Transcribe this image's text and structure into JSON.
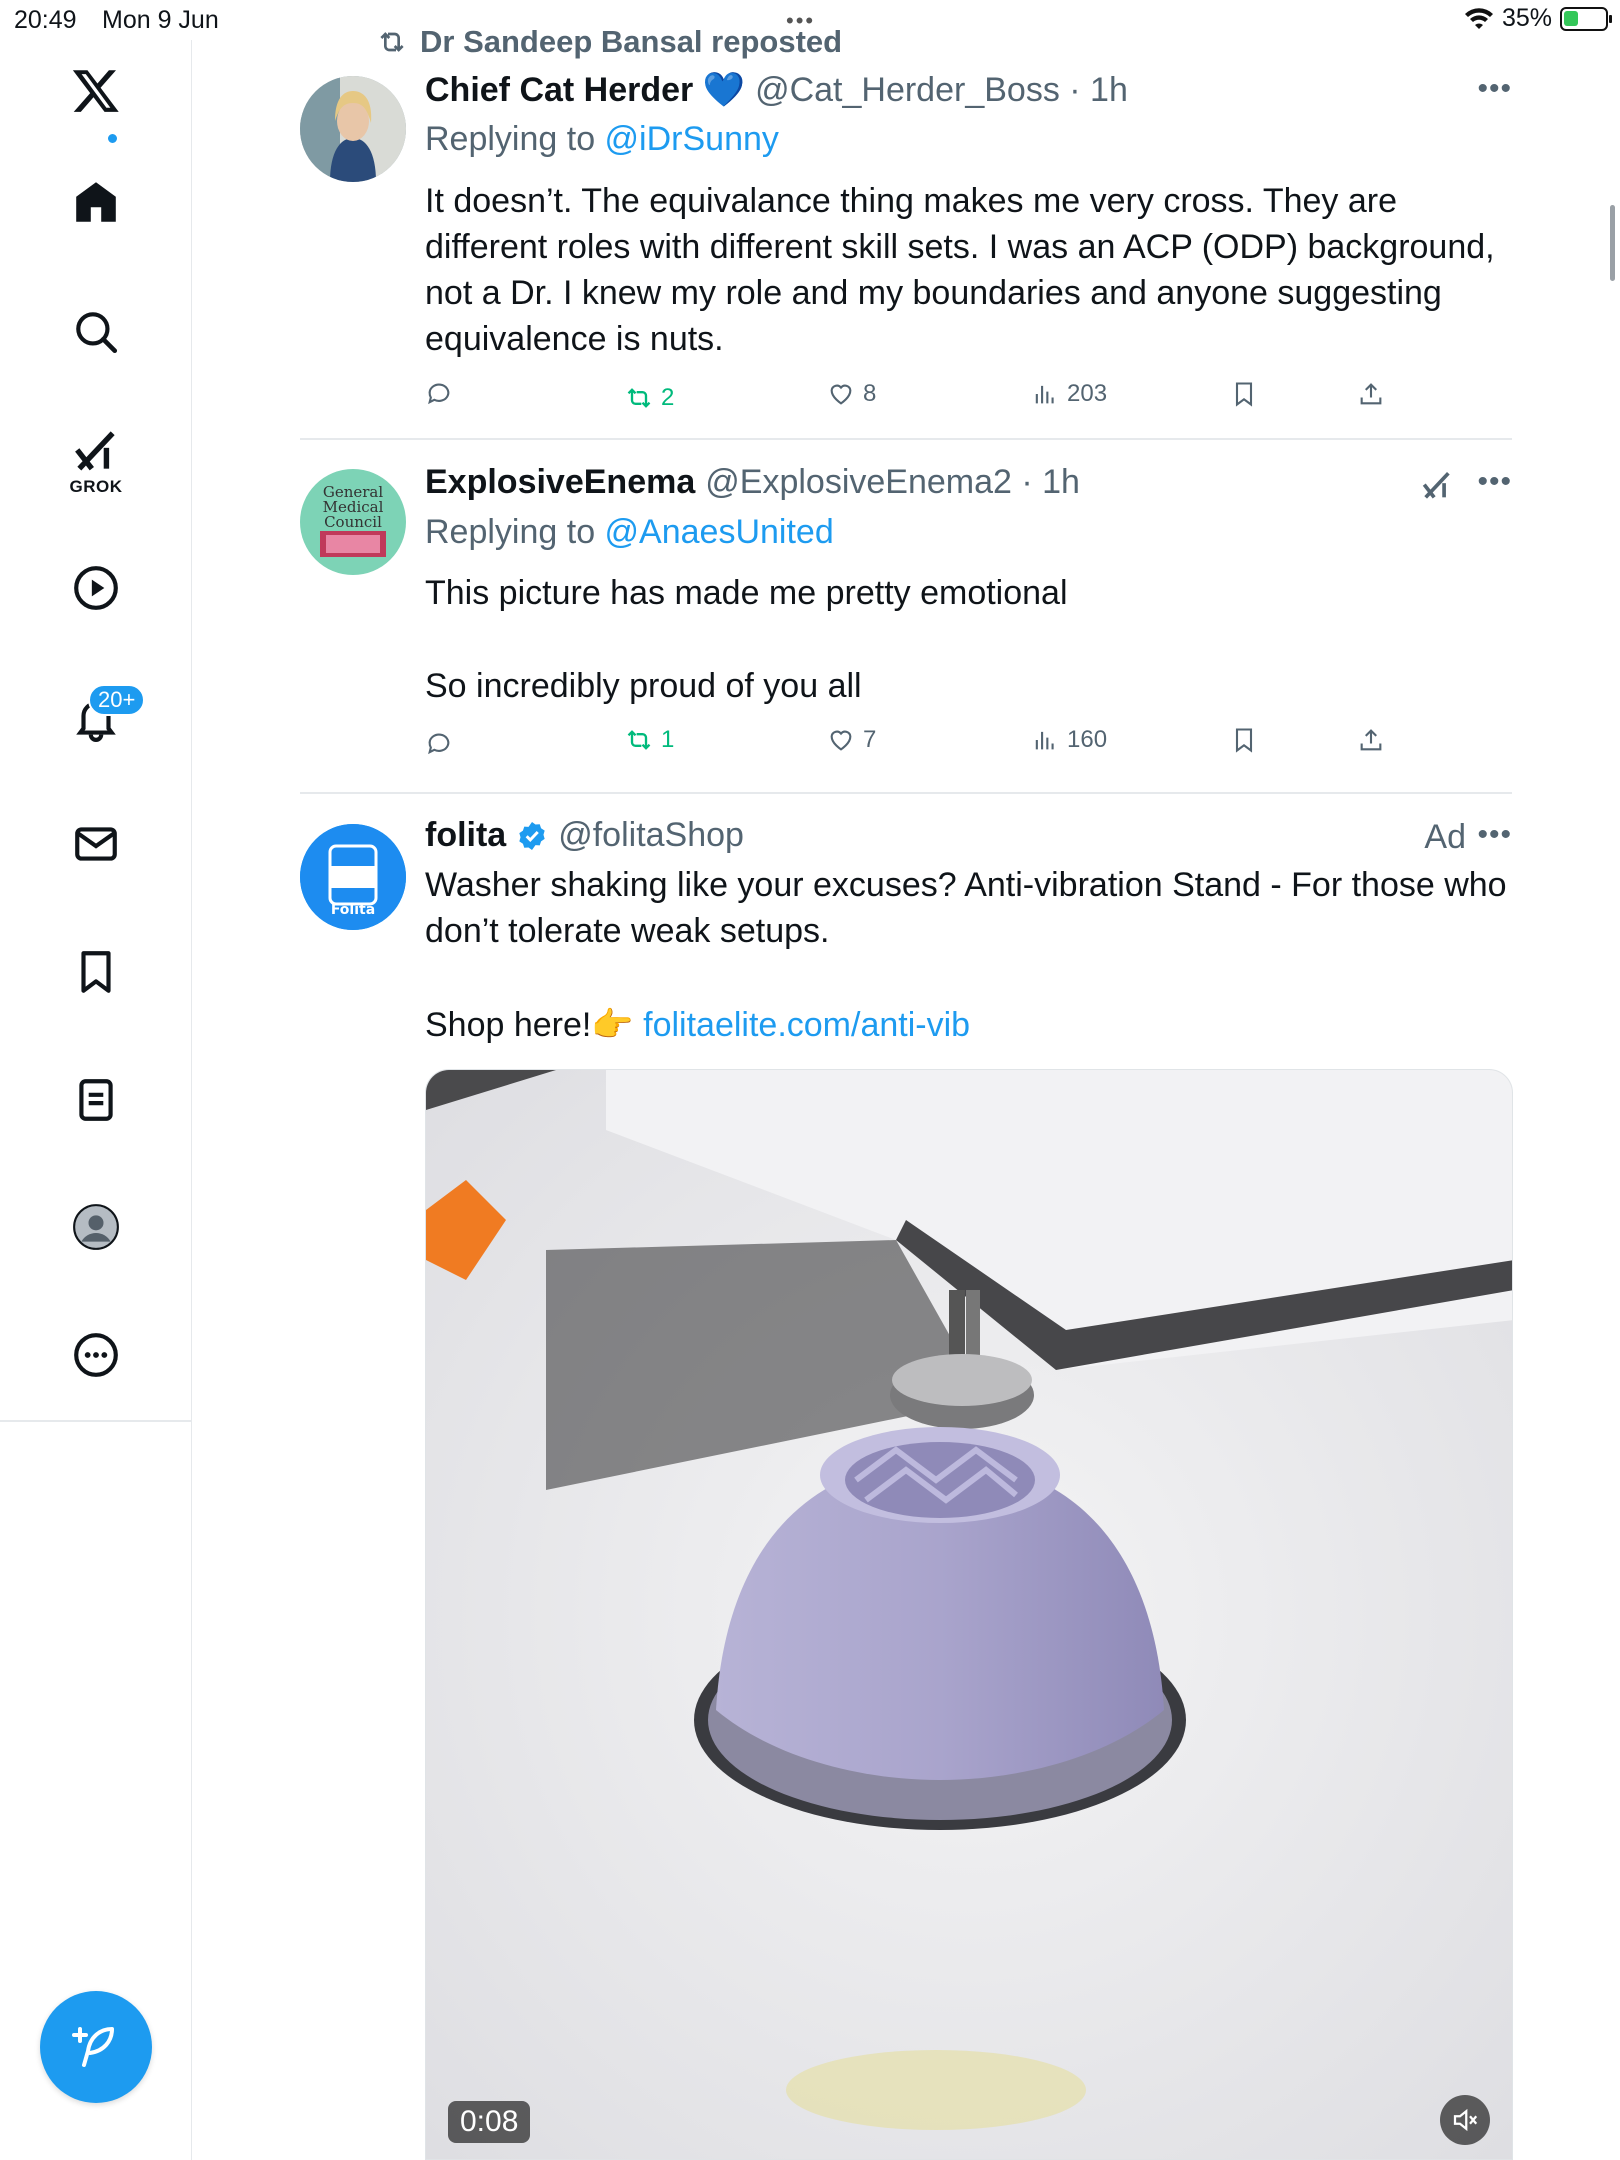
{
  "status_bar": {
    "time": "20:49",
    "date": "Mon 9 Jun",
    "battery": "35%",
    "battery_level": 0.35
  },
  "sidebar": {
    "items": [
      {
        "name": "logo",
        "icon": "x-logo"
      },
      {
        "name": "home",
        "icon": "home-icon"
      },
      {
        "name": "explore",
        "icon": "search-icon"
      },
      {
        "name": "grok",
        "icon": "grok-icon",
        "label": "GROK"
      },
      {
        "name": "video",
        "icon": "play-icon"
      },
      {
        "name": "notifications",
        "icon": "bell-icon",
        "badge": "20+"
      },
      {
        "name": "messages",
        "icon": "mail-icon"
      },
      {
        "name": "bookmarks",
        "icon": "bookmark-icon"
      },
      {
        "name": "lists",
        "icon": "list-icon"
      },
      {
        "name": "profile",
        "icon": "avatar-icon"
      },
      {
        "name": "more",
        "icon": "more-circle-icon"
      }
    ],
    "compose_icon": "compose-icon"
  },
  "feed": {
    "repost_banner": "Dr Sandeep Bansal reposted",
    "tweets": [
      {
        "name": "Chief Cat Herder 💙",
        "handle": "@Cat_Herder_Boss · 1h",
        "replying_prefix": "Replying to ",
        "replying_to": "@iDrSunny",
        "body": "It doesn’t. The equivalance thing makes me very cross. They are different roles with different skill sets. I was an ACP (ODP) background, not a Dr. I knew my role and my boundaries and anyone suggesting equivalence is nuts.",
        "retweets": "2",
        "likes": "8",
        "views": "203"
      },
      {
        "name": "ExplosiveEnema",
        "handle": "@ExplosiveEnema2 · 1h",
        "replying_prefix": "Replying to ",
        "replying_to": "@AnaesUnited",
        "avatar_text": "General Medical Council",
        "body_line1": "This picture has made me pretty emotional",
        "body_line2": "So incredibly proud of you all",
        "retweets": "1",
        "likes": "7",
        "views": "160"
      },
      {
        "name": "folita",
        "handle": "@folitaShop",
        "ad_label": "Ad",
        "avatar_text": "Folita",
        "body": "Washer shaking like your excuses? Anti-vibration Stand - For those who don’t tolerate weak setups.",
        "shop_text": "Shop here!👉",
        "link": "folitaelite.com/anti-vib",
        "video_time": "0:08"
      }
    ]
  },
  "colors": {
    "accent": "#1d9bf0",
    "retweet": "#00ba7c",
    "muted": "#536471"
  }
}
